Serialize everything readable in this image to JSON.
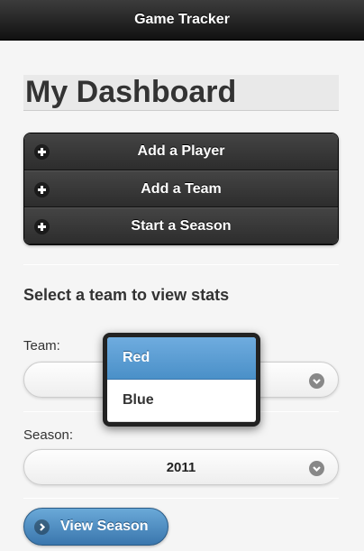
{
  "header": {
    "title": "Game Tracker"
  },
  "page": {
    "title": "My Dashboard"
  },
  "actions": [
    {
      "label": "Add a Player",
      "icon": "plus-icon"
    },
    {
      "label": "Add a Team",
      "icon": "plus-icon"
    },
    {
      "label": "Start a Season",
      "icon": "plus-icon"
    }
  ],
  "stats": {
    "section_title": "Select a team to view stats",
    "team_label": "Team:",
    "team_value": "",
    "season_label": "Season:",
    "season_value": "2011",
    "view_button": "View Season"
  },
  "team_popup": {
    "options": [
      "Red",
      "Blue"
    ],
    "highlighted": "Red"
  }
}
